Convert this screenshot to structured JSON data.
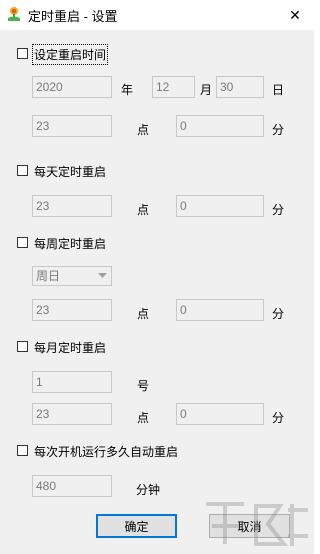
{
  "window": {
    "title": "定时重启 - 设置",
    "close_glyph": "✕"
  },
  "sections": {
    "set_restart_time": {
      "label": "设定重启时间",
      "checked": false,
      "year_value": "2020",
      "year_unit": "年",
      "month_value": "12",
      "month_unit": "月",
      "day_value": "30",
      "day_unit": "日",
      "hour_value": "23",
      "hour_unit": "点",
      "minute_value": "0",
      "minute_unit": "分"
    },
    "daily": {
      "label": "每天定时重启",
      "checked": false,
      "hour_value": "23",
      "hour_unit": "点",
      "minute_value": "0",
      "minute_unit": "分"
    },
    "weekly": {
      "label": "每周定时重启",
      "checked": false,
      "weekday_value": "周日",
      "hour_value": "23",
      "hour_unit": "点",
      "minute_value": "0",
      "minute_unit": "分"
    },
    "monthly": {
      "label": "每月定时重启",
      "checked": false,
      "day_value": "1",
      "day_unit": "号",
      "hour_value": "23",
      "hour_unit": "点",
      "minute_value": "0",
      "minute_unit": "分"
    },
    "after_boot": {
      "label": "每次开机运行多久自动重启",
      "checked": false,
      "minutes_value": "480",
      "minutes_unit": "分钟"
    }
  },
  "buttons": {
    "ok_label": "确定",
    "cancel_label": "取消"
  },
  "icons": {
    "app": "flower-icon",
    "close": "close-icon",
    "dropdown": "chevron-down-icon"
  },
  "colors": {
    "dialog_bg": "#f0f0f0",
    "disabled_text": "#7a7a7a",
    "default_button_border": "#0078d7"
  }
}
